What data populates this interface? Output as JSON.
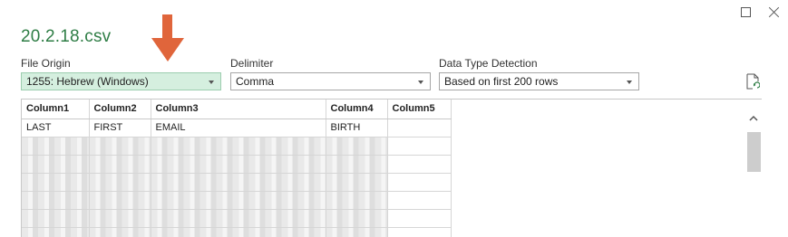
{
  "window": {
    "maximize_icon": "maximize-icon",
    "close_icon": "close-icon"
  },
  "title": "20.2.18.csv",
  "file_origin": {
    "label": "File Origin",
    "value": "1255: Hebrew (Windows)"
  },
  "delimiter": {
    "label": "Delimiter",
    "value": "Comma"
  },
  "data_type_detection": {
    "label": "Data Type Detection",
    "value": "Based on first 200 rows"
  },
  "colors": {
    "title": "#2e7d45",
    "highlight": "#d5efdf",
    "arrow": "#e0653b"
  },
  "table": {
    "headers": [
      "Column1",
      "Column2",
      "Column3",
      "Column4",
      "Column5"
    ],
    "first_row": [
      "LAST",
      "FIRST",
      "EMAIL",
      "BIRTH",
      ""
    ]
  }
}
